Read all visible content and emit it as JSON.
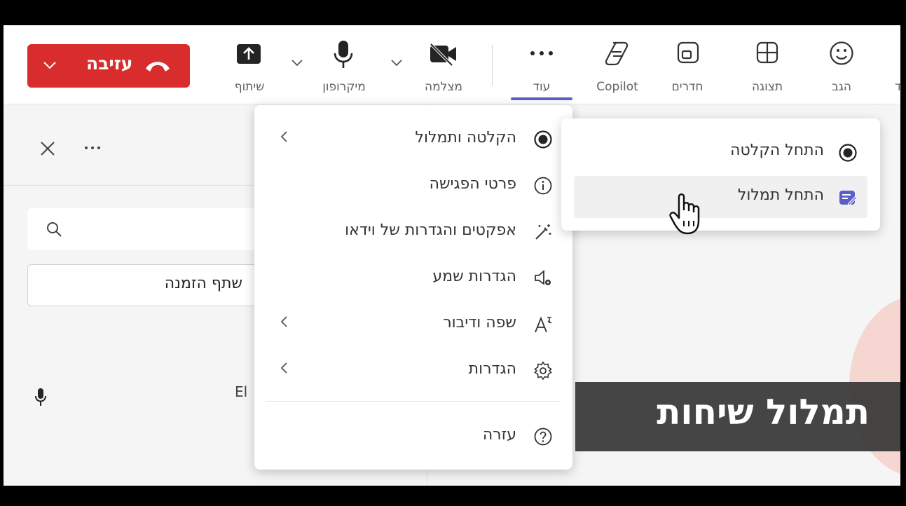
{
  "toolbar": {
    "leave_label": "עזיבה",
    "share_label": "שיתוף",
    "mic_label": "מיקרופון",
    "camera_label": "מצלמה",
    "more_label": "עוד",
    "copilot_label": "Copilot",
    "rooms_label": "חדרים",
    "view_label": "תצוגה",
    "react_label": "הגב",
    "cut_edge_label": "ד"
  },
  "panel": {
    "invite_label": "שתף הזמנה",
    "participant_partial": "El"
  },
  "menu": {
    "items": [
      {
        "label": "הקלטה ותמלול",
        "icon": "record-icon",
        "has_submenu": true
      },
      {
        "label": "פרטי הפגישה",
        "icon": "info-icon",
        "has_submenu": false
      },
      {
        "label": "אפקטים והגדרות של וידאו",
        "icon": "magic-wand-icon",
        "has_submenu": false
      },
      {
        "label": "הגדרות שמע",
        "icon": "speaker-settings-icon",
        "has_submenu": false
      },
      {
        "label": "שפה ודיבור",
        "icon": "language-icon",
        "has_submenu": true
      },
      {
        "label": "הגדרות",
        "icon": "gear-icon",
        "has_submenu": true
      },
      {
        "label": "עזרה",
        "icon": "help-icon",
        "has_submenu": false
      }
    ]
  },
  "submenu": {
    "items": [
      {
        "label": "התחל הקלטה",
        "icon": "record-icon"
      },
      {
        "label": "התחל תמלול",
        "icon": "transcript-icon"
      }
    ]
  },
  "caption": {
    "text": "תמלול שיחות"
  },
  "colors": {
    "leave_red": "#d92c2c",
    "accent": "#5b5fc7"
  }
}
